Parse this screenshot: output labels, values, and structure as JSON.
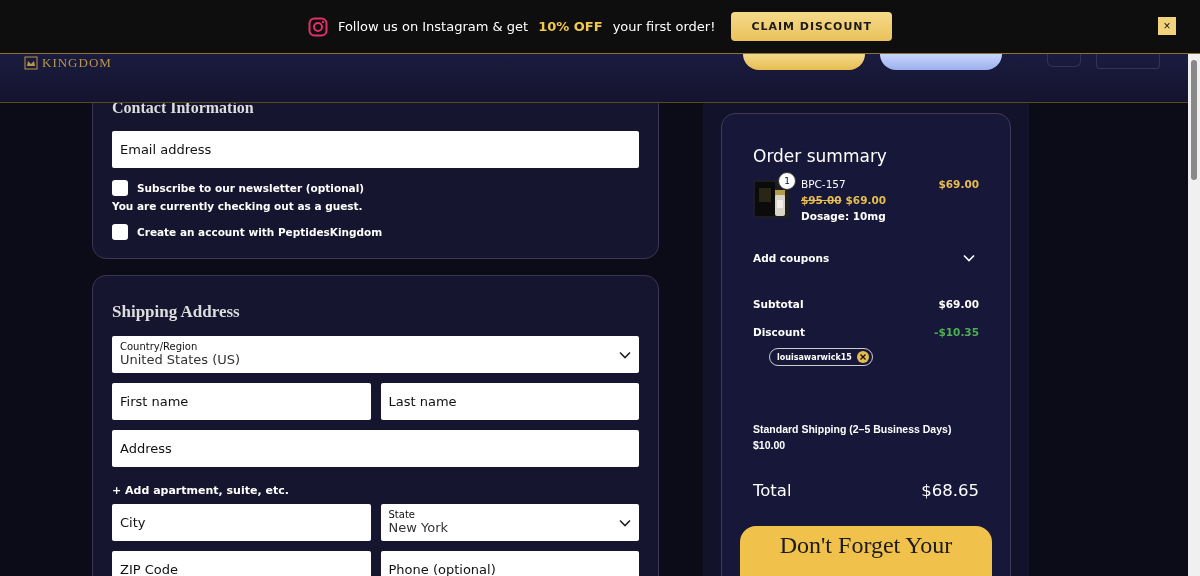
{
  "promo": {
    "text": "Follow us on Instagram & get",
    "highlight": "10% OFF",
    "text_after": "your first order!",
    "button": "CLAIM DISCOUNT",
    "close": "×"
  },
  "nav": {
    "logo": "KINGDOM"
  },
  "contact": {
    "title": "Contact Information",
    "email": {
      "placeholder": "Email address"
    },
    "newsletter": {
      "label": "Subscribe to our newsletter (optional)",
      "checked": false
    },
    "guest_note": "You are currently checking out as a guest.",
    "create_account": {
      "label": "Create an account with PeptidesKingdom",
      "checked": false
    }
  },
  "shipping": {
    "title": "Shipping Address",
    "country": {
      "label": "Country/Region",
      "value": "United States (US)"
    },
    "first_name": {
      "placeholder": "First name"
    },
    "last_name": {
      "placeholder": "Last name"
    },
    "address": {
      "placeholder": "Address"
    },
    "add_apartment": "+ Add apartment, suite, etc.",
    "city": {
      "placeholder": "City"
    },
    "state": {
      "label": "State",
      "value": "New York"
    },
    "zip": {
      "placeholder": "ZIP Code"
    },
    "phone": {
      "placeholder": "Phone (optional)"
    }
  },
  "summary": {
    "title": "Order summary",
    "item": {
      "quantity": "1",
      "name": "BPC-157",
      "old_price": "$95.00",
      "price": "$69.00",
      "dosage": "Dosage: 10mg",
      "line_total": "$69.00"
    },
    "add_coupons": "Add coupons",
    "expanded": false,
    "subtotal_label": "Subtotal",
    "subtotal": "$69.00",
    "discount_label": "Discount",
    "discount": "-$10.35",
    "coupon": "louisawarwick15",
    "shipping": "Standard Shipping (2–5 Business Days)",
    "shipping_price": "$10.00",
    "total_label": "Total",
    "total": "$68.65",
    "cta": "Don't Forget Your"
  }
}
